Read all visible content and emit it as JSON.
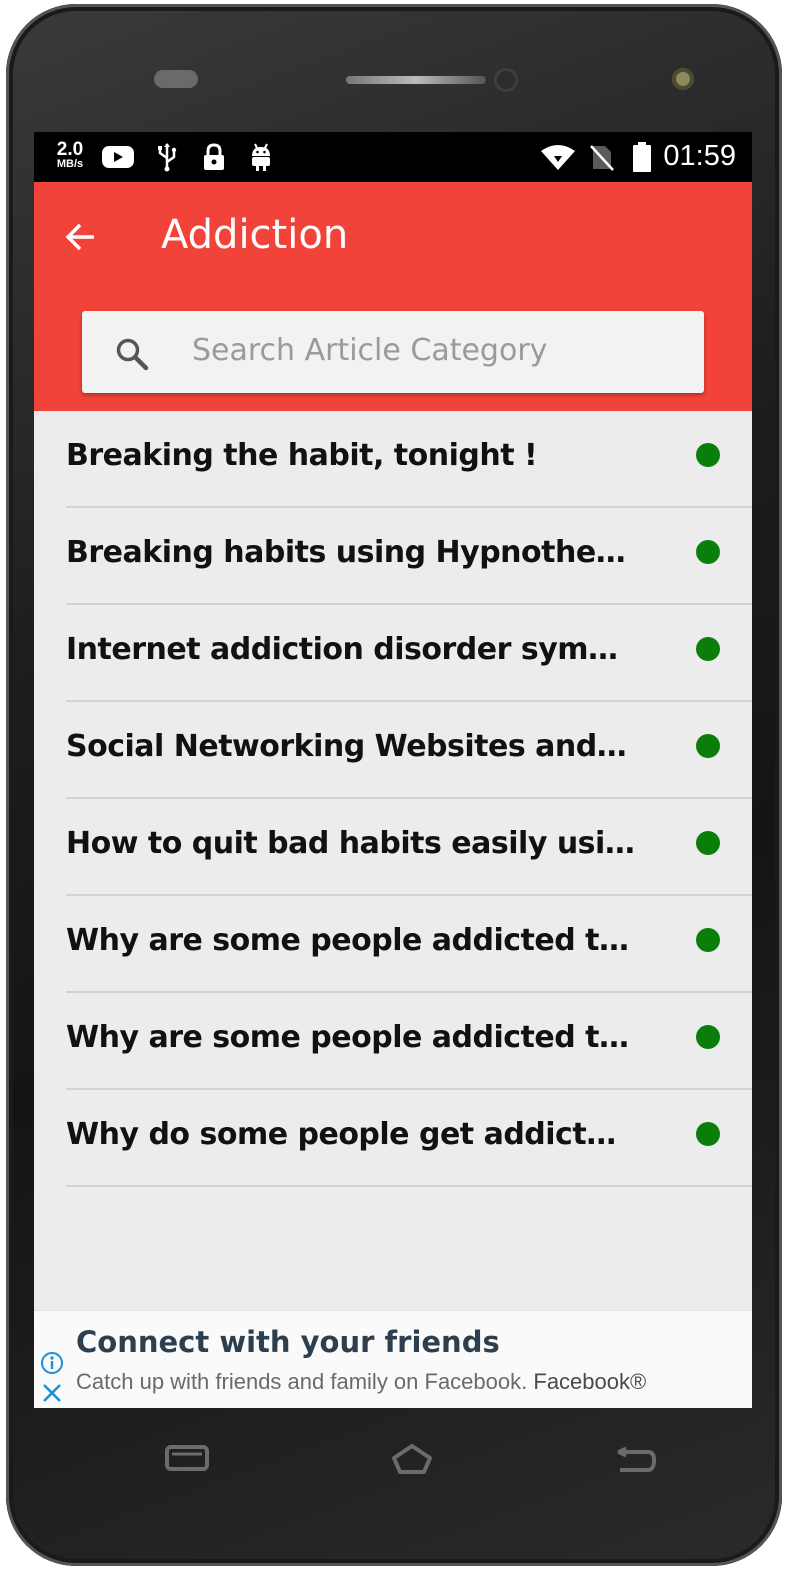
{
  "statusbar": {
    "speed_value": "2.0",
    "speed_unit": "MB/s",
    "time": "01:59",
    "left_icons": [
      "youtube-icon",
      "usb-icon",
      "lock-icon",
      "android-icon"
    ],
    "right_icons": [
      "wifi-icon",
      "no-sim-icon",
      "battery-icon"
    ]
  },
  "appbar": {
    "title": "Addiction",
    "back_icon": "arrow-back-icon",
    "color": "#f2433a"
  },
  "search": {
    "placeholder": "Search Article Category"
  },
  "articles": [
    {
      "label": "Breaking the habit, tonight !"
    },
    {
      "label": "Breaking habits using Hypnotherapy"
    },
    {
      "label": "Internet addiction disorder symptoms and treatment"
    },
    {
      "label": "Social Networking Websites and Facebook addiction"
    },
    {
      "label": "How to quit bad habits easily using the power of the subconscious"
    },
    {
      "label": "Why are some people addicted to exercise"
    },
    {
      "label": "Why are some people addicted to news"
    },
    {
      "label": "Why do some people get addicted to gambling"
    }
  ],
  "status_dot_color": "#0a7d0a",
  "ad": {
    "title": "Connect with your friends",
    "body": "Catch up with friends and family on Facebook.",
    "brand": "Facebook®"
  },
  "navbar": {
    "icons": [
      "recent-apps-icon",
      "home-icon",
      "back-nav-icon"
    ]
  }
}
